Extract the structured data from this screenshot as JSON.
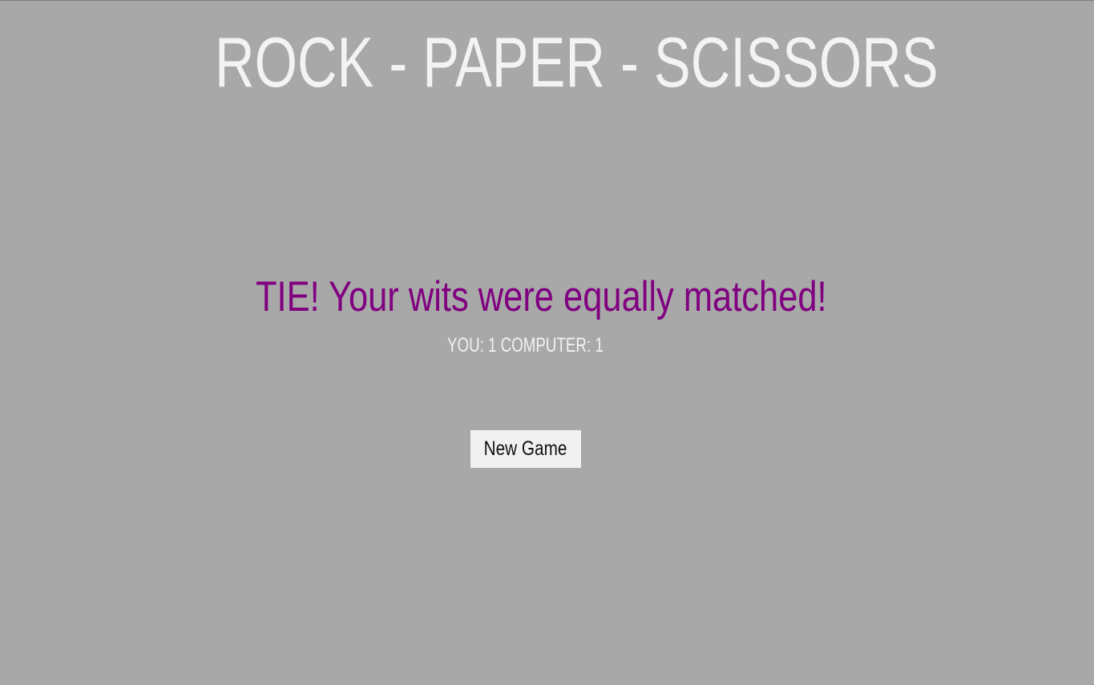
{
  "game": {
    "title": "ROCK - PAPER - SCISSORS",
    "result_message": "TIE! Your wits were equally matched!",
    "score_text": "YOU: 1 COMPUTER: 1",
    "new_game_label": "New Game"
  },
  "colors": {
    "background": "#a8a8a8",
    "title_text": "#f3f3f3",
    "result_text": "#800080",
    "button_background": "#f1f1f1"
  }
}
